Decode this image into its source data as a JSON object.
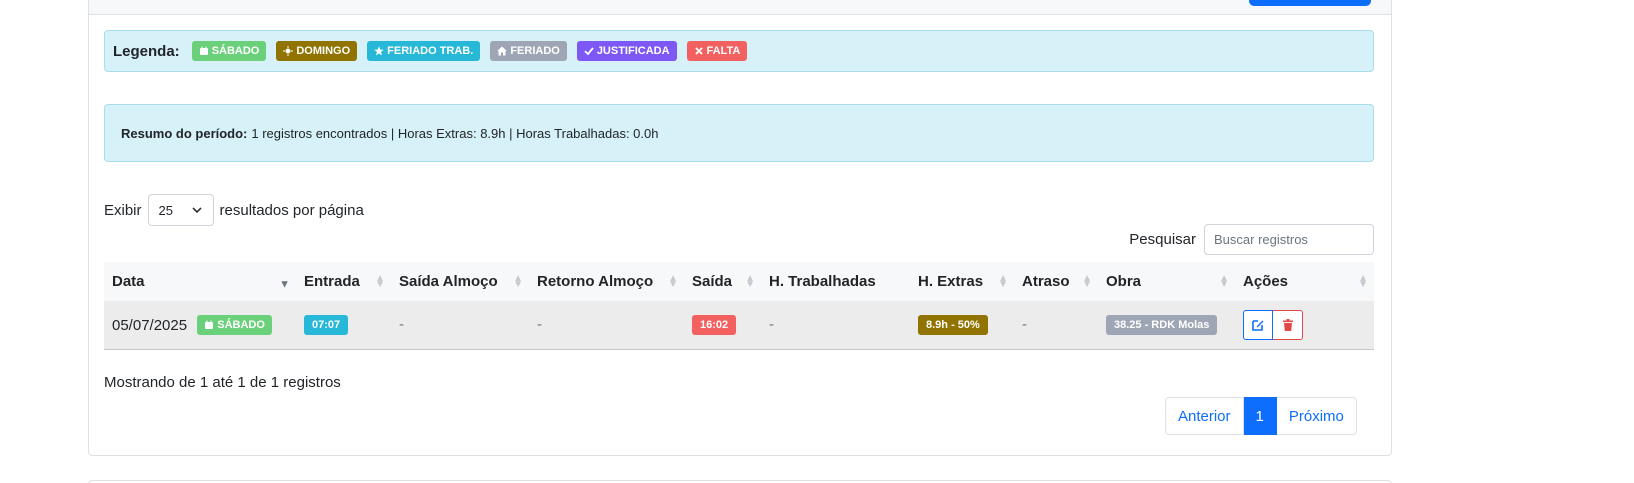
{
  "legend": {
    "title": "Legenda:",
    "items": [
      {
        "label": "SÁBADO",
        "icon": "calendar-icon",
        "color": "#6ad07a"
      },
      {
        "label": "DOMINGO",
        "icon": "sun-icon",
        "color": "#917300"
      },
      {
        "label": "FERIADO TRAB.",
        "icon": "star-icon",
        "color": "#27b8d8"
      },
      {
        "label": "FERIADO",
        "icon": "home-icon",
        "color": "#9ea6b6"
      },
      {
        "label": "JUSTIFICADA",
        "icon": "check-icon",
        "color": "#7d58f5"
      },
      {
        "label": "FALTA",
        "icon": "x-icon",
        "color": "#f26060"
      }
    ]
  },
  "summary": {
    "label": "Resumo do período:",
    "text": "1 registros encontrados | Horas Extras: 8.9h | Horas Trabalhadas: 0.0h"
  },
  "length_menu": {
    "prefix": "Exibir",
    "value": "25",
    "suffix": "resultados por página"
  },
  "search": {
    "label": "Pesquisar",
    "placeholder": "Buscar registros",
    "value": ""
  },
  "table": {
    "columns": [
      "Data",
      "Entrada",
      "Saída Almoço",
      "Retorno Almoço",
      "Saída",
      "H. Trabalhadas",
      "H. Extras",
      "Atraso",
      "Obra",
      "Ações"
    ],
    "rows": [
      {
        "data": "05/07/2025",
        "data_badge": "SÁBADO",
        "entrada": "07:07",
        "saida_almoco": "-",
        "retorno_almoco": "-",
        "saida": "16:02",
        "h_trabalhadas": "-",
        "h_extras": "8.9h - 50%",
        "atraso": "-",
        "obra": "38.25 - RDK Molas"
      }
    ]
  },
  "info": "Mostrando de 1 até 1 de 1 registros",
  "pagination": {
    "previous": "Anterior",
    "current": "1",
    "next": "Próximo"
  },
  "colors": {
    "primary": "#0d6efd",
    "info_bg": "#d6f1f7",
    "danger": "#f26060"
  }
}
